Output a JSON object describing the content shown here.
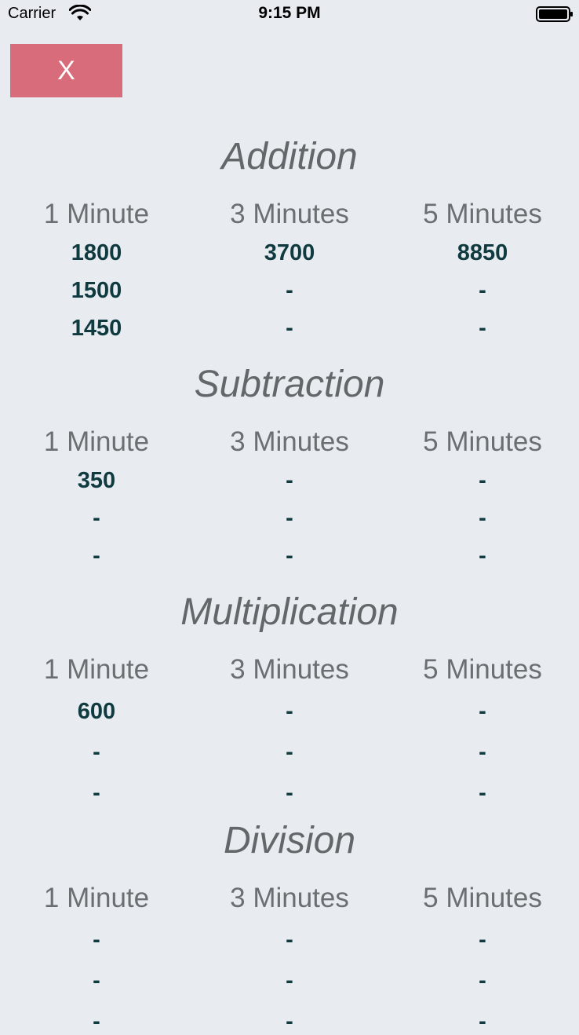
{
  "status_bar": {
    "carrier": "Carrier",
    "time": "9:15 PM",
    "wifi_icon": "wifi-icon",
    "battery_icon": "battery-icon"
  },
  "close_button": {
    "label": "X",
    "color": "#d96c7a"
  },
  "colors": {
    "background": "#e8ecf0",
    "title": "#636769",
    "header": "#6b6f72",
    "score": "#0e3a40"
  },
  "sections": [
    {
      "title": "Addition",
      "headers": [
        "1 Minute",
        "3 Minutes",
        "5 Minutes"
      ],
      "rows": [
        [
          "1800",
          "3700",
          "8850"
        ],
        [
          "1500",
          "-",
          "-"
        ],
        [
          "1450",
          "-",
          "-"
        ]
      ]
    },
    {
      "title": "Subtraction",
      "headers": [
        "1 Minute",
        "3 Minutes",
        "5 Minutes"
      ],
      "rows": [
        [
          "350",
          "-",
          "-"
        ],
        [
          "-",
          "-",
          "-"
        ],
        [
          "-",
          "-",
          "-"
        ]
      ]
    },
    {
      "title": "Multiplication",
      "headers": [
        "1 Minute",
        "3 Minutes",
        "5 Minutes"
      ],
      "rows": [
        [
          "600",
          "-",
          "-"
        ],
        [
          "-",
          "-",
          "-"
        ],
        [
          "-",
          "-",
          "-"
        ]
      ]
    },
    {
      "title": "Division",
      "headers": [
        "1 Minute",
        "3 Minutes",
        "5 Minutes"
      ],
      "rows": [
        [
          "-",
          "-",
          "-"
        ],
        [
          "-",
          "-",
          "-"
        ],
        [
          "-",
          "-",
          "-"
        ]
      ]
    }
  ]
}
